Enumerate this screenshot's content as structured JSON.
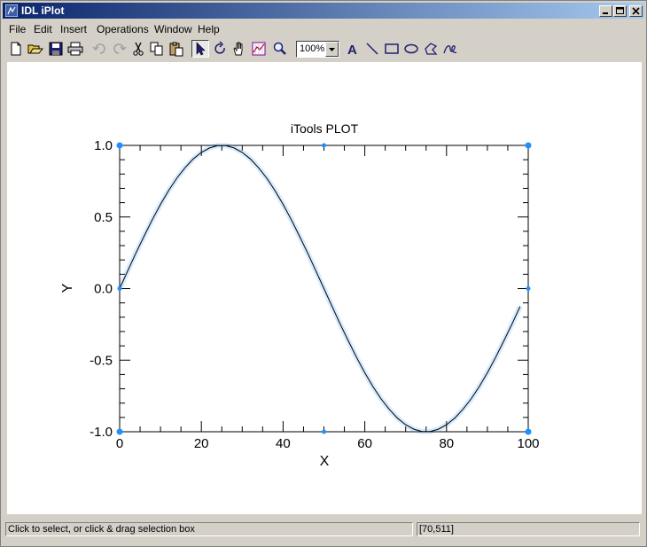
{
  "window": {
    "title": "IDL iPlot"
  },
  "menu": [
    {
      "label": "File"
    },
    {
      "label": "Edit"
    },
    {
      "label": "Insert"
    },
    {
      "label": "Operations"
    },
    {
      "label": "Window"
    },
    {
      "label": "Help"
    }
  ],
  "toolbar": {
    "zoom_value": "100%"
  },
  "status": {
    "message": "Click to select, or click & drag selection box",
    "coords": "[70,511]"
  },
  "chart_data": {
    "type": "line",
    "title": "iTools PLOT",
    "xlabel": "X",
    "ylabel": "Y",
    "xlim": [
      0,
      100
    ],
    "ylim": [
      -1.0,
      1.0
    ],
    "xticks": [
      "0",
      "20",
      "40",
      "60",
      "80",
      "100"
    ],
    "yticks": [
      "-1.0",
      "-0.5",
      "0.0",
      "0.5",
      "1.0"
    ],
    "series": [
      {
        "x": [
          0,
          2,
          4,
          6,
          8,
          10,
          12,
          14,
          16,
          18,
          20,
          22,
          24,
          26,
          28,
          30,
          32,
          34,
          36,
          38,
          40,
          42,
          44,
          46,
          48,
          50,
          52,
          54,
          56,
          58,
          60,
          62,
          64,
          66,
          68,
          70,
          72,
          74,
          76,
          78,
          80,
          82,
          84,
          86,
          88,
          90,
          92,
          94,
          96,
          98
        ],
        "y": [
          0.0,
          0.125,
          0.249,
          0.368,
          0.482,
          0.588,
          0.685,
          0.771,
          0.844,
          0.905,
          0.951,
          0.982,
          0.998,
          0.998,
          0.982,
          0.951,
          0.905,
          0.844,
          0.771,
          0.685,
          0.588,
          0.482,
          0.368,
          0.249,
          0.125,
          0.0,
          -0.125,
          -0.249,
          -0.368,
          -0.482,
          -0.588,
          -0.685,
          -0.771,
          -0.844,
          -0.905,
          -0.951,
          -0.982,
          -0.998,
          -0.998,
          -0.982,
          -0.951,
          -0.905,
          -0.844,
          -0.771,
          -0.685,
          -0.588,
          -0.482,
          -0.368,
          -0.249,
          -0.125
        ],
        "color": "#000000",
        "selection_color": "#1e90ff"
      }
    ]
  }
}
